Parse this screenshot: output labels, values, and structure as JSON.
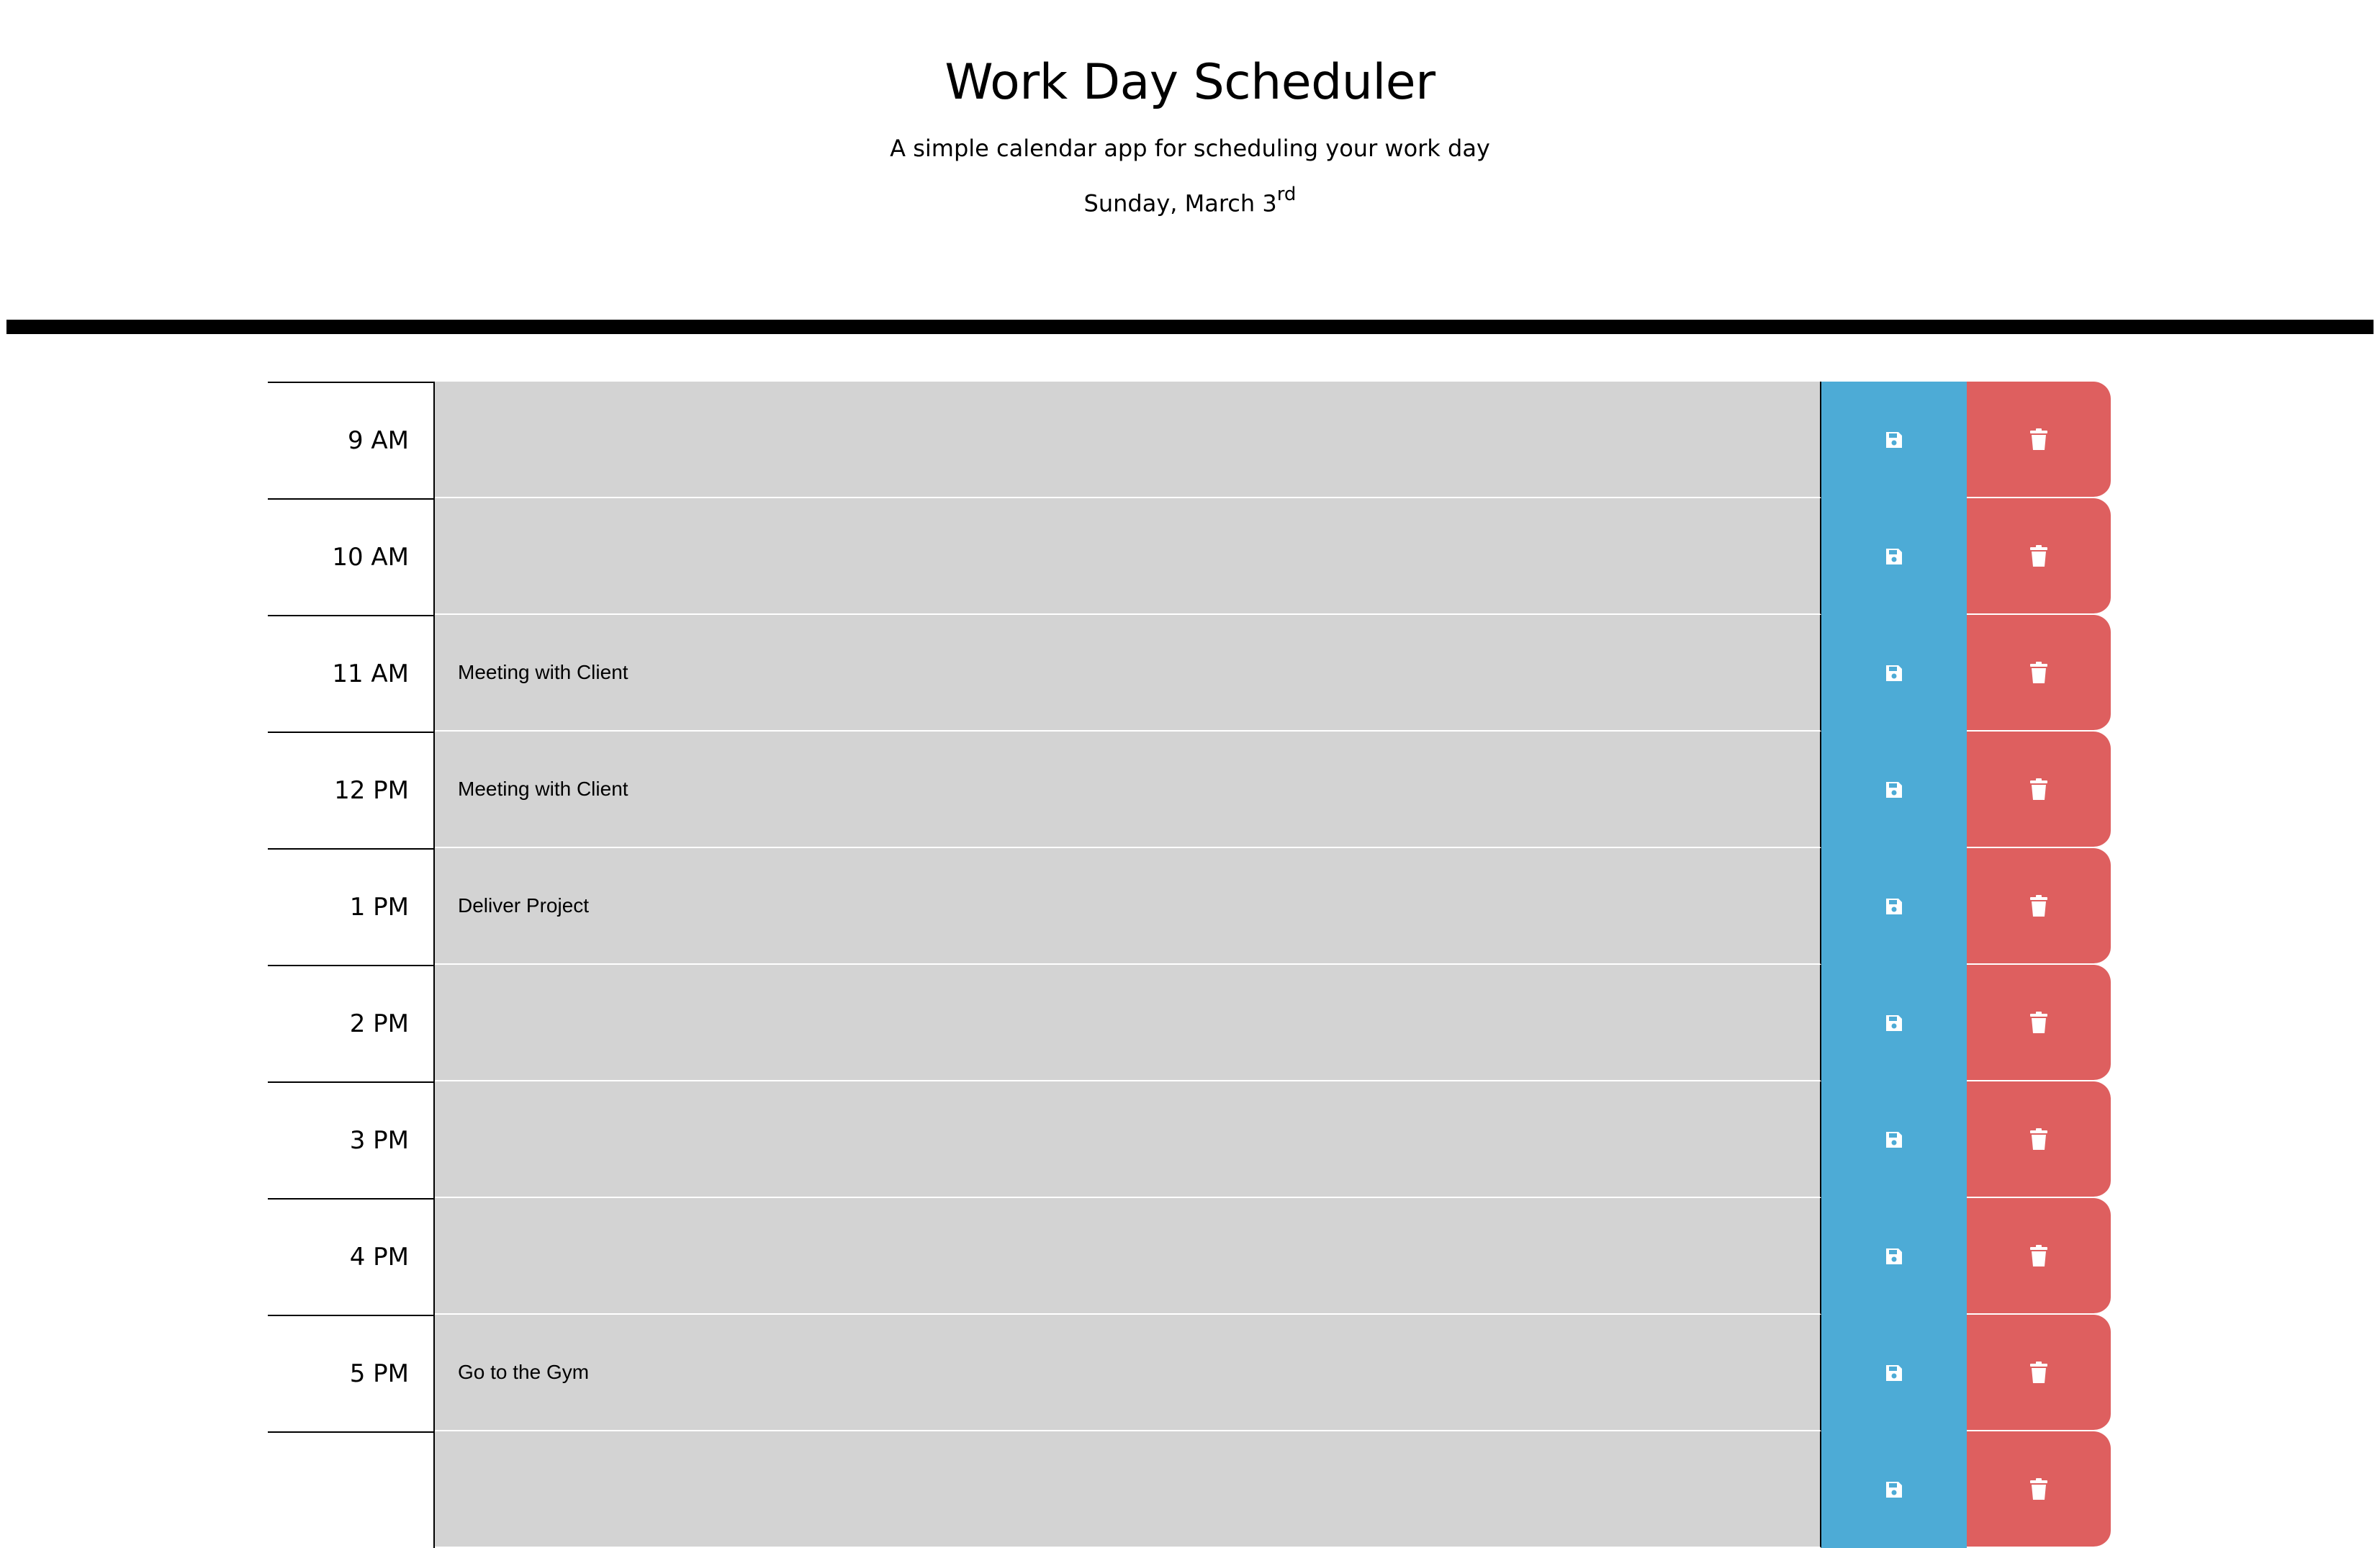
{
  "header": {
    "title": "Work Day Scheduler",
    "subtitle": "A simple calendar app for scheduling your work day",
    "date_main": "Sunday, March 3",
    "date_suffix": "rd"
  },
  "timeblocks": [
    {
      "hour": "9 AM",
      "text": ""
    },
    {
      "hour": "10 AM",
      "text": ""
    },
    {
      "hour": "11 AM",
      "text": "Meeting with Client"
    },
    {
      "hour": "12 PM",
      "text": "Meeting with Client"
    },
    {
      "hour": "1 PM",
      "text": "Deliver Project"
    },
    {
      "hour": "2 PM",
      "text": ""
    },
    {
      "hour": "3 PM",
      "text": ""
    },
    {
      "hour": "4 PM",
      "text": ""
    },
    {
      "hour": "5 PM",
      "text": "Go to the Gym"
    },
    {
      "hour": "",
      "text": ""
    }
  ],
  "icons": {
    "save": "floppy-disk-icon",
    "delete": "trash-icon"
  },
  "colors": {
    "past_block": "#d3d3d3",
    "save_button": "#4dabd6",
    "delete_button": "#de5f5f",
    "divider": "#000000"
  }
}
